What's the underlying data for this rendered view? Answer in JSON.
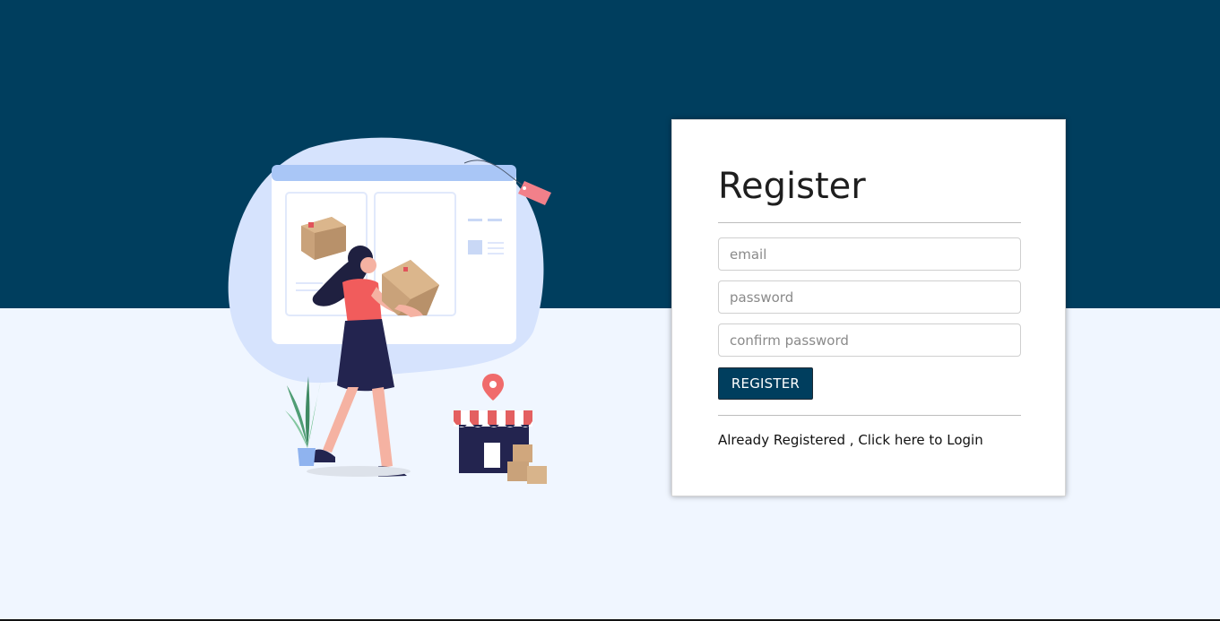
{
  "register_form": {
    "title": "Register",
    "email_placeholder": "email",
    "password_placeholder": "password",
    "confirm_password_placeholder": "confirm password",
    "submit_label": "REGISTER",
    "login_link": "Already Registered , Click here to Login"
  },
  "illustration": {
    "icon": "shopping-delivery-illustration"
  },
  "colors": {
    "header_band": "#003e5e",
    "page_background": "#f0f6ff",
    "button_background": "#003e5e",
    "button_text": "#ffffff",
    "card_background": "#ffffff"
  }
}
